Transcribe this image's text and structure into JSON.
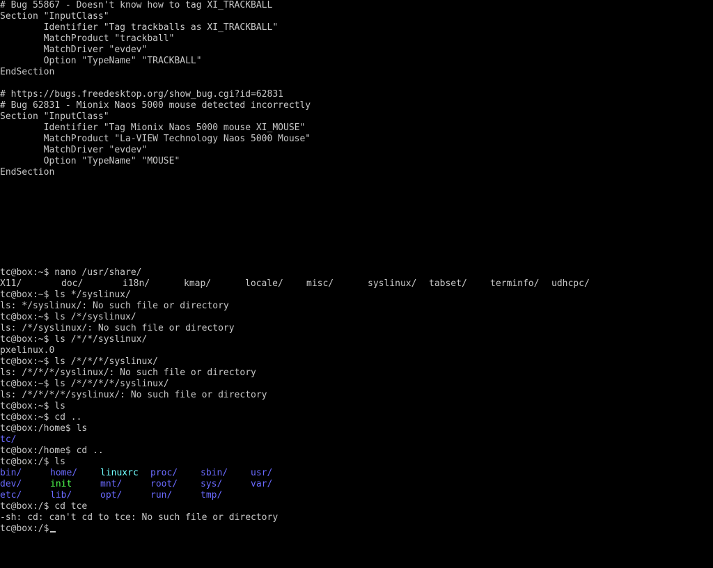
{
  "config_lines": [
    "# Bug 55867 - Doesn't know how to tag XI_TRACKBALL",
    "Section \"InputClass\"",
    "        Identifier \"Tag trackballs as XI_TRACKBALL\"",
    "        MatchProduct \"trackball\"",
    "        MatchDriver \"evdev\"",
    "        Option \"TypeName\" \"TRACKBALL\"",
    "EndSection",
    "",
    "# https://bugs.freedesktop.org/show_bug.cgi?id=62831",
    "# Bug 62831 - Mionix Naos 5000 mouse detected incorrectly",
    "Section \"InputClass\"",
    "        Identifier \"Tag Mionix Naos 5000 mouse XI_MOUSE\"",
    "        MatchProduct \"La-VIEW Technology Naos 5000 Mouse\"",
    "        MatchDriver \"evdev\"",
    "        Option \"TypeName\" \"MOUSE\"",
    "EndSection"
  ],
  "shell": {
    "nano_cmd": "tc@box:~$ nano /usr/share/",
    "completion": [
      "X11/",
      "doc/",
      "i18n/",
      "kmap/",
      "locale/",
      "misc/",
      "syslinux/",
      "tabset/",
      "terminfo/",
      "udhcpc/"
    ],
    "lines_a": [
      "tc@box:~$ ls */syslinux/",
      "ls: */syslinux/: No such file or directory",
      "tc@box:~$ ls /*/syslinux/",
      "ls: /*/syslinux/: No such file or directory",
      "tc@box:~$ ls /*/*/syslinux/",
      "pxelinux.0",
      "tc@box:~$ ls /*/*/*/syslinux/",
      "ls: /*/*/*/syslinux/: No such file or directory",
      "tc@box:~$ ls /*/*/*/*/syslinux/",
      "ls: /*/*/*/*/syslinux/: No such file or directory",
      "tc@box:~$ ls",
      "tc@box:~$ cd ..",
      "tc@box:/home$ ls"
    ],
    "home_listing": "tc/",
    "lines_b": [
      "tc@box:/home$ cd ..",
      "tc@box:/$ ls"
    ],
    "root_listing": [
      [
        "bin/",
        "home/",
        "linuxrc",
        "proc/",
        "sbin/",
        "usr/"
      ],
      [
        "dev/",
        "init",
        "mnt/",
        "root/",
        "sys/",
        "var/"
      ],
      [
        "etc/",
        "lib/",
        "opt/",
        "run/",
        "tmp/"
      ]
    ],
    "lines_c": [
      "tc@box:/$ cd tce",
      "-sh: cd: can't cd to tce: No such file or directory",
      "tc@box:/$ "
    ]
  },
  "colors": {
    "background": "#000000",
    "text": "#c8c8c8",
    "directory": "#6a6aff",
    "executable": "#50ff50",
    "symlink": "#70ffff"
  }
}
